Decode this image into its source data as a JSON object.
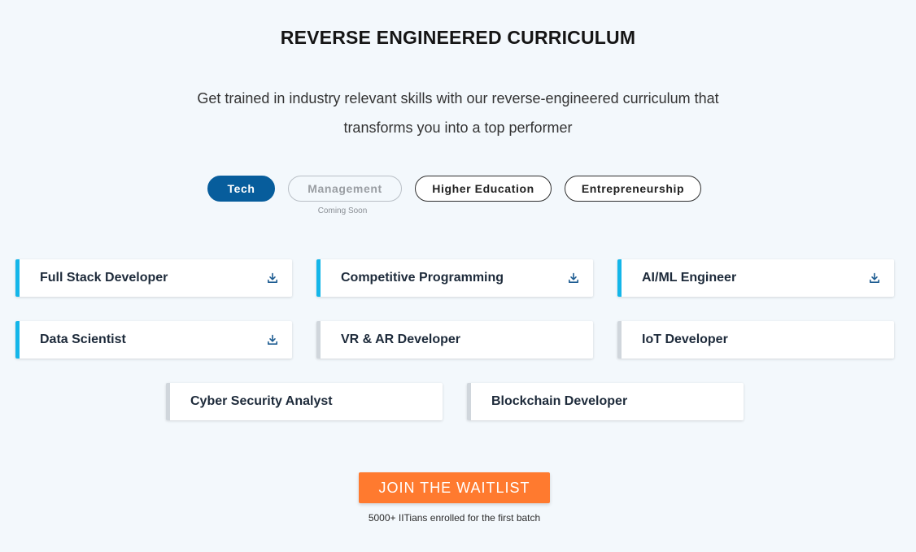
{
  "page": {
    "title": "REVERSE ENGINEERED CURRICULUM",
    "subtitle_line1": "Get trained in industry relevant skills with our reverse-engineered curriculum that",
    "subtitle_line2": "transforms you into a top performer"
  },
  "tabs": [
    {
      "label": "Tech",
      "state": "active"
    },
    {
      "label": "Management",
      "state": "disabled"
    },
    {
      "label": "Higher Education",
      "state": "default"
    },
    {
      "label": "Entrepreneurship",
      "state": "default"
    }
  ],
  "coming_soon": "Coming Soon",
  "curriculum": [
    {
      "label": "Full Stack Developer",
      "download": true
    },
    {
      "label": "Competitive Programming",
      "download": true
    },
    {
      "label": "AI/ML Engineer",
      "download": true
    },
    {
      "label": "Data Scientist",
      "download": true
    },
    {
      "label": "VR & AR Developer",
      "download": false
    },
    {
      "label": "IoT Developer",
      "download": false
    },
    {
      "label": "Cyber Security Analyst",
      "download": false
    },
    {
      "label": "Blockchain Developer",
      "download": false
    }
  ],
  "cta": {
    "label": "JOIN THE WAITLIST",
    "note": "5000+ IITians enrolled for the first batch"
  },
  "colors": {
    "background": "#f3f8fc",
    "active_tab": "#075d9c",
    "accent_bar": "#14b6e9",
    "inactive_bar": "#d0d6dc",
    "cta": "#ff7a2f",
    "download_icon": "#1f5d92"
  },
  "icons": {
    "download": "download-icon"
  }
}
